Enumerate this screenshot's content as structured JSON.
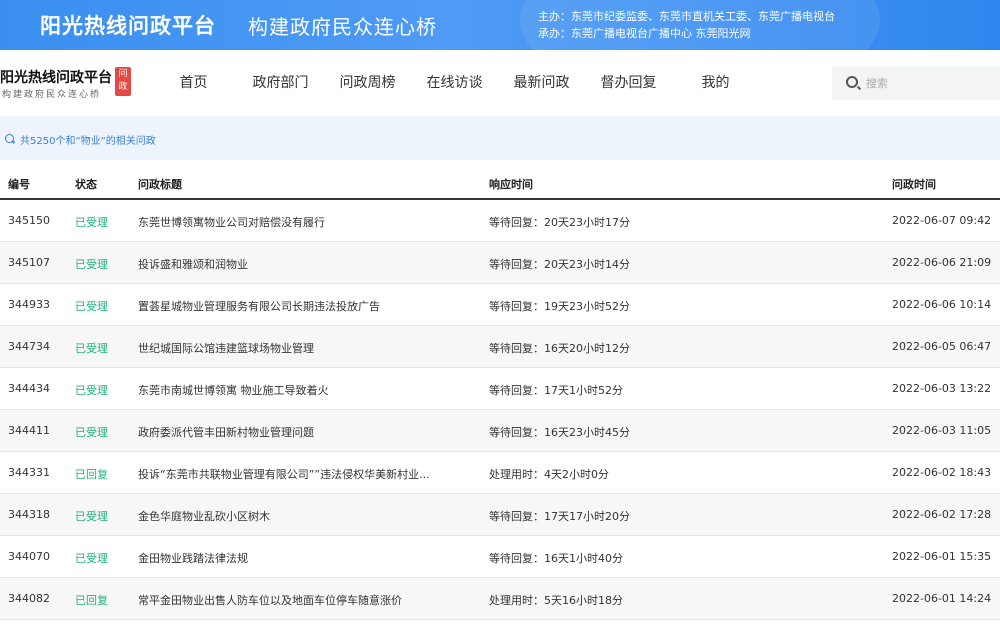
{
  "banner": {
    "title": "阳光热线问政平台",
    "subtitle": "构建政府民众连心桥",
    "host_line1": "主办：东莞市纪委监委、东莞市直机关工委、东莞广播电视台",
    "host_line2": "承办：东莞广播电视台广播中心 东莞阳光网"
  },
  "logo": {
    "main": "阳光热线问政平台",
    "sub": "构建政府民众连心桥",
    "badge": "问政"
  },
  "nav": [
    "首页",
    "政府部门",
    "问政周榜",
    "在线访谈",
    "最新问政",
    "督办回复",
    "我的"
  ],
  "search": {
    "placeholder": "搜索"
  },
  "result": {
    "text": "共5250个和“物业”的相关问政"
  },
  "table": {
    "headers": {
      "id": "编号",
      "status": "状态",
      "title": "问政标题",
      "response": "响应时间",
      "time": "问政时间"
    },
    "rows": [
      {
        "id": "345150",
        "status": "已受理",
        "title": "东莞世博领寓物业公司对赔偿没有履行",
        "response": "等待回复：20天23小时17分",
        "time": "2022-06-07 09:42"
      },
      {
        "id": "345107",
        "status": "已受理",
        "title": "投诉盛和雅颂和润物业",
        "response": "等待回复：20天23小时14分",
        "time": "2022-06-06 21:09"
      },
      {
        "id": "344933",
        "status": "已受理",
        "title": "置荟星城物业管理服务有限公司长期违法投放广告",
        "response": "等待回复：19天23小时52分",
        "time": "2022-06-06 10:14"
      },
      {
        "id": "344734",
        "status": "已受理",
        "title": "世纪城国际公馆违建篮球场物业管理",
        "response": "等待回复：16天20小时12分",
        "time": "2022-06-05 06:47"
      },
      {
        "id": "344434",
        "status": "已受理",
        "title": "东莞市南城世博领寓 物业施工导致着火",
        "response": "等待回复：17天1小时52分",
        "time": "2022-06-03 13:22"
      },
      {
        "id": "344411",
        "status": "已受理",
        "title": "政府委派代管丰田新村物业管理问题",
        "response": "等待回复：16天23小时45分",
        "time": "2022-06-03 11:05"
      },
      {
        "id": "344331",
        "status": "已回复",
        "title": "投诉“东莞市共联物业管理有限公司””违法侵权华美新村业...",
        "response": "处理用时：4天2小时0分",
        "time": "2022-06-02 18:43"
      },
      {
        "id": "344318",
        "status": "已受理",
        "title": "金色华庭物业乱砍小区树木",
        "response": "等待回复：17天17小时20分",
        "time": "2022-06-02 17:28"
      },
      {
        "id": "344070",
        "status": "已受理",
        "title": "金田物业践踏法律法规",
        "response": "等待回复：16天1小时40分",
        "time": "2022-06-01 15:35"
      },
      {
        "id": "344082",
        "status": "已回复",
        "title": "常平金田物业出售人防车位以及地面车位停车随意涨价",
        "response": "处理用时：5天16小时18分",
        "time": "2022-06-01 14:24"
      }
    ]
  }
}
